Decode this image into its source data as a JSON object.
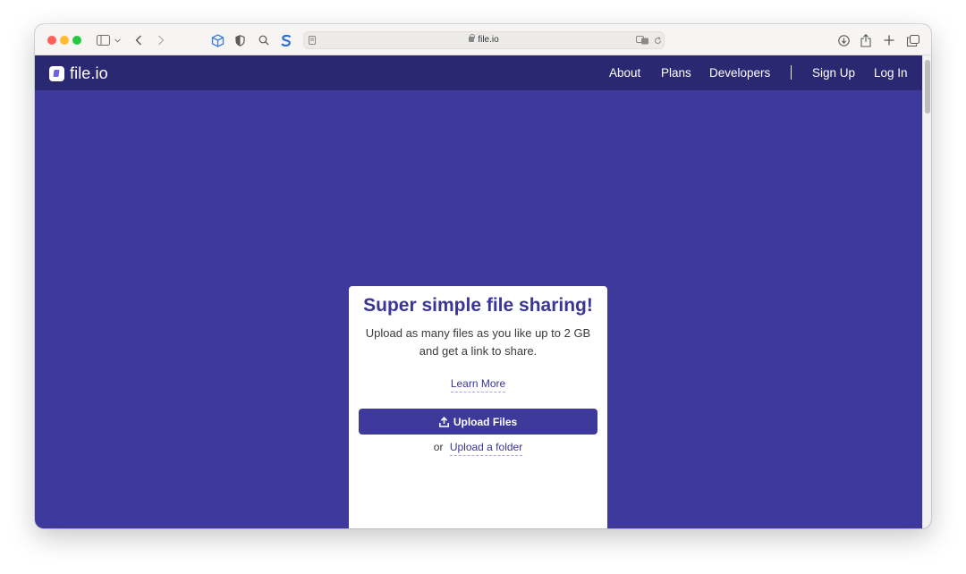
{
  "browser": {
    "url": "file.io",
    "icons": [
      "sidebar-icon",
      "chevron-down-icon",
      "back-icon",
      "forward-icon",
      "extension-box-icon",
      "shield-icon",
      "search-icon",
      "s-extension-icon",
      "reader-icon",
      "translate-icon",
      "reload-icon",
      "download-icon",
      "share-icon",
      "new-tab-icon",
      "tabs-overview-icon"
    ]
  },
  "nav": {
    "logo_text": "file.io",
    "links": [
      "About",
      "Plans",
      "Developers",
      "Sign Up",
      "Log In"
    ]
  },
  "card": {
    "title": "Super simple file sharing!",
    "subtitle_line1": "Upload as many files as you like up to 2 GB",
    "subtitle_line2": "and get a link to share.",
    "learn_more": "Learn More",
    "upload_button": "Upload Files",
    "or_text": "or",
    "folder_link": "Upload a folder"
  },
  "colors": {
    "page_bg": "#3e3a9c",
    "nav_bg": "#2b2872",
    "accent": "#3a3596"
  }
}
